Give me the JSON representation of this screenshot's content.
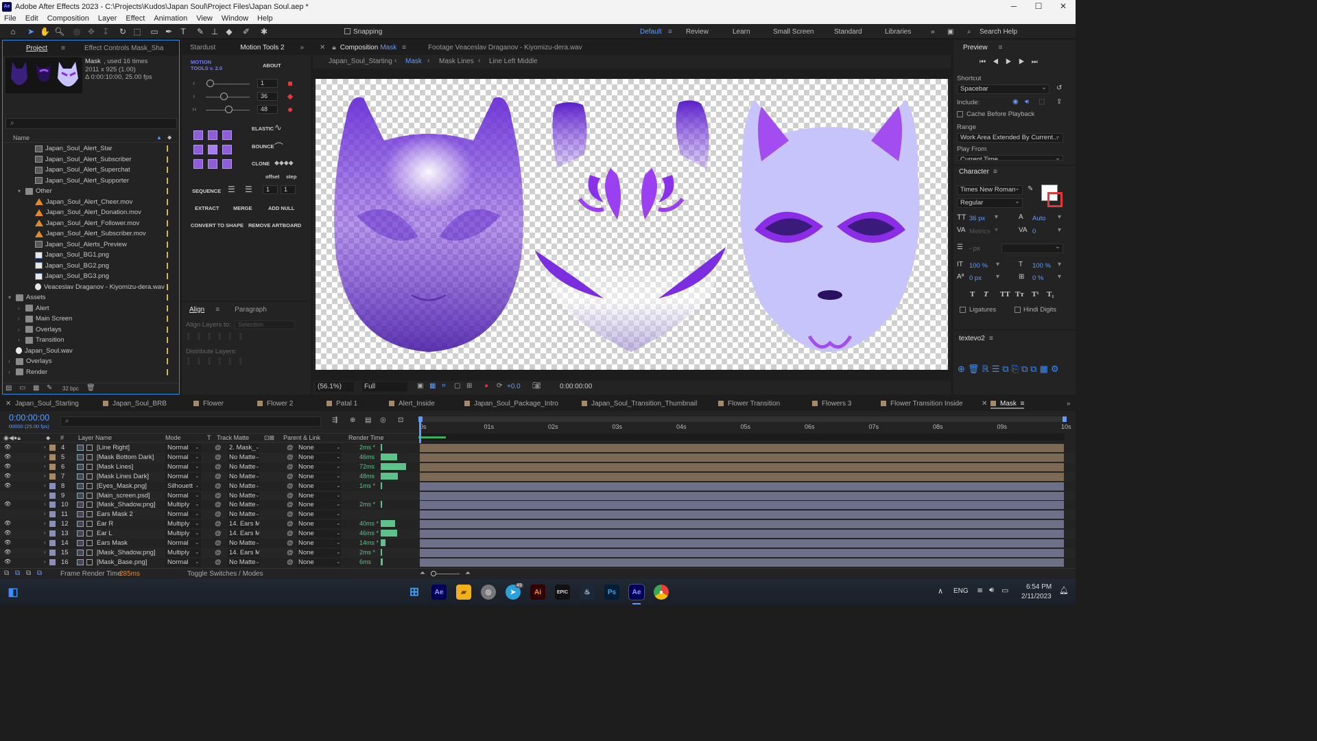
{
  "window": {
    "title": "Adobe After Effects 2023 - C:\\Projects\\Kudos\\Japan Soul\\Project Files\\Japan Soul.aep *",
    "app_badge": "Ae",
    "minimize": "─",
    "maximize": "☐",
    "close": "✕"
  },
  "menu": [
    "File",
    "Edit",
    "Composition",
    "Layer",
    "Effect",
    "Animation",
    "View",
    "Window",
    "Help"
  ],
  "toolbar": {
    "snapping": "Snapping",
    "workspaces": [
      "Default",
      "Review",
      "Learn",
      "Small Screen",
      "Standard",
      "Libraries"
    ],
    "active_workspace": "Default",
    "search_placeholder": "Search Help"
  },
  "project": {
    "tab_project": "Project",
    "tab_effect_controls": "Effect Controls  Mask_Sha",
    "selected_name": "Mask",
    "used_times": ", used 16 times",
    "dims": "2011 x 925 (1.00)",
    "duration": "Δ 0:00:10:00, 25.00 fps",
    "search_placeholder": "",
    "column_name": "Name",
    "bpc": "32 bpc",
    "items": [
      {
        "name": "Japan_Soul_Alert_Star",
        "type": "comp",
        "indent": 2
      },
      {
        "name": "Japan_Soul_Alert_Subscriber",
        "type": "comp",
        "indent": 2
      },
      {
        "name": "Japan_Soul_Alert_Superchat",
        "type": "comp",
        "indent": 2
      },
      {
        "name": "Japan_Soul_Alert_Supporter",
        "type": "comp",
        "indent": 2
      },
      {
        "name": "Other",
        "type": "folder",
        "indent": 1,
        "open": true
      },
      {
        "name": "Japan_Soul_Alert_Cheer.mov",
        "type": "mov",
        "indent": 2
      },
      {
        "name": "Japan_Soul_Alert_Donation.mov",
        "type": "mov",
        "indent": 2
      },
      {
        "name": "Japan_Soul_Alert_Follower.mov",
        "type": "mov",
        "indent": 2
      },
      {
        "name": "Japan_Soul_Alert_Subscriber.mov",
        "type": "mov",
        "indent": 2
      },
      {
        "name": "Japan_Soul_Alerts_Preview",
        "type": "comp",
        "indent": 2
      },
      {
        "name": "Japan_Soul_BG1.png",
        "type": "img",
        "indent": 2
      },
      {
        "name": "Japan_Soul_BG2.png",
        "type": "img",
        "indent": 2
      },
      {
        "name": "Japan_Soul_BG3.png",
        "type": "img",
        "indent": 2
      },
      {
        "name": "Veaceslav Draganov - Kiyomizu-dera.wav",
        "type": "wav",
        "indent": 2
      },
      {
        "name": "Assets",
        "type": "folder",
        "indent": 0,
        "open": true
      },
      {
        "name": "Alert",
        "type": "folder",
        "indent": 1
      },
      {
        "name": "Main Screen",
        "type": "folder",
        "indent": 1
      },
      {
        "name": "Overlays",
        "type": "folder",
        "indent": 1
      },
      {
        "name": "Transition",
        "type": "folder",
        "indent": 1
      },
      {
        "name": "Japan_Soul.wav",
        "type": "wav",
        "indent": 0
      },
      {
        "name": "Overlays",
        "type": "folder",
        "indent": 0
      },
      {
        "name": "Render",
        "type": "folder",
        "indent": 0
      }
    ]
  },
  "motion_tools": {
    "tab_stardust": "Stardust",
    "tab_motion": "Motion Tools 2",
    "logo_line1": "MOTION",
    "logo_line2": "TOOLS v. 2.0",
    "about": "ABOUT",
    "values": [
      "1",
      "36",
      "48"
    ],
    "elastic": "ELASTIC",
    "bounce": "BOUNCE",
    "clone": "CLONE",
    "offset": "offset",
    "step": "step",
    "sequence": "SEQUENCE",
    "seq_values": [
      "1",
      "1"
    ],
    "extract": "EXTRACT",
    "merge": "MERGE",
    "add_null": "ADD NULL",
    "convert": "CONVERT TO SHAPE",
    "remove": "REMOVE ARTBOARD"
  },
  "align": {
    "tab_align": "Align",
    "tab_paragraph": "Paragraph",
    "align_to": "Align Layers to:",
    "selection": "Selection",
    "distribute": "Distribute Layers:"
  },
  "composition": {
    "tab_label": "Composition",
    "comp_name": "Mask",
    "footage_tab": "Footage  Veaceslav Draganov - Kiyomizu-dera.wav",
    "breadcrumbs": [
      "Japan_Soul_Starting",
      "Mask",
      "Mask Lines",
      "Line Left Middle"
    ],
    "zoom": "(56.1%)",
    "quality": "Full",
    "exposure": "+0.0",
    "timecode": "0:00:00:00"
  },
  "preview": {
    "title": "Preview",
    "shortcut_label": "Shortcut",
    "shortcut": "Spacebar",
    "include": "Include:",
    "cache": "Cache Before Playback",
    "range_label": "Range",
    "range": "Work Area Extended By Current...",
    "play_from": "Play From",
    "play_from_value": "Current Time"
  },
  "character": {
    "title": "Character",
    "font": "Times New Roman",
    "style": "Regular",
    "size": "36 px",
    "leading": "Auto",
    "kerning": "Metrics",
    "tracking": "0",
    "stroke": "- px",
    "vscale": "100 %",
    "hscale": "100 %",
    "baseline": "0 px",
    "tsume": "0 %",
    "styles": [
      "T",
      "T",
      "TT",
      "Tт",
      "T¹",
      "T₁"
    ],
    "ligatures": "Ligatures",
    "hindi": "Hindi Digits"
  },
  "textevo": {
    "title": "textevo2"
  },
  "timeline": {
    "tabs": [
      "Japan_Soul_Starting",
      "Japan_Soul_BRB",
      "Flower",
      "Flower 2",
      "Patal 1",
      "Alert_Inside",
      "Japan_Soul_Package_Intro",
      "Japan_Soul_Transition_Thumbnail",
      "Flower Transition",
      "Flowers 3",
      "Flower Transition Inside",
      "Mask"
    ],
    "timecode": "0:00:00:00",
    "fps": "00000 (25.00 fps)",
    "headers": {
      "num": "#",
      "layer_name": "Layer Name",
      "mode": "Mode",
      "t": "T",
      "track_matte": "Track Matte",
      "parent": "Parent & Link",
      "render_time": "Render Time"
    },
    "ruler": [
      "0s",
      "01s",
      "02s",
      "03s",
      "04s",
      "05s",
      "06s",
      "07s",
      "08s",
      "09s",
      "10s"
    ],
    "layers": [
      {
        "num": "4",
        "name": "[Line Right]",
        "mode": "Normal",
        "matte": "2. Mask_",
        "parent": "None",
        "rt": "2ms *",
        "rt_ms": 2,
        "color": "#a58a6a",
        "visible": true
      },
      {
        "num": "5",
        "name": "[Mask Bottom Dark]",
        "mode": "Normal",
        "matte": "No Matte",
        "parent": "None",
        "rt": "46ms",
        "rt_ms": 46,
        "color": "#a58a6a",
        "visible": true
      },
      {
        "num": "6",
        "name": "[Mask Lines]",
        "mode": "Normal",
        "matte": "No Matte",
        "parent": "None",
        "rt": "72ms",
        "rt_ms": 72,
        "color": "#a58a6a",
        "visible": true
      },
      {
        "num": "7",
        "name": "[Mask Lines Dark]",
        "mode": "Normal",
        "matte": "No Matte",
        "parent": "None",
        "rt": "48ms",
        "rt_ms": 48,
        "color": "#a58a6a",
        "visible": true
      },
      {
        "num": "8",
        "name": "[Eyes_Mask.png]",
        "mode": "Silhouett",
        "matte": "No Matte",
        "parent": "None",
        "rt": "1ms *",
        "rt_ms": 1,
        "color": "#8a8fb5",
        "visible": true
      },
      {
        "num": "9",
        "name": "[Main_screen.psd]",
        "mode": "Normal",
        "matte": "No Matte",
        "parent": "None",
        "rt": "",
        "rt_ms": 0,
        "color": "#8a8fb5",
        "visible": false
      },
      {
        "num": "10",
        "name": "[Mask_Shadow.png]",
        "mode": "Multiply",
        "matte": "No Matte",
        "parent": "None",
        "rt": "2ms *",
        "rt_ms": 2,
        "color": "#8a8fb5",
        "visible": true
      },
      {
        "num": "11",
        "name": "Ears Mask 2",
        "mode": "Normal",
        "matte": "No Matte",
        "parent": "None",
        "rt": "",
        "rt_ms": 0,
        "color": "#8a8fb5",
        "visible": false
      },
      {
        "num": "12",
        "name": "Ear R",
        "mode": "Multiply",
        "matte": "14. Ears M",
        "parent": "None",
        "rt": "40ms *",
        "rt_ms": 40,
        "color": "#8a8fb5",
        "visible": true
      },
      {
        "num": "13",
        "name": "Ear L",
        "mode": "Multiply",
        "matte": "14. Ears M",
        "parent": "None",
        "rt": "46ms *",
        "rt_ms": 46,
        "color": "#8a8fb5",
        "visible": true
      },
      {
        "num": "14",
        "name": "Ears Mask",
        "mode": "Normal",
        "matte": "No Matte",
        "parent": "None",
        "rt": "14ms *",
        "rt_ms": 14,
        "color": "#8a8fb5",
        "visible": true
      },
      {
        "num": "15",
        "name": "[Mask_Shadow.png]",
        "mode": "Multiply",
        "matte": "14. Ears M",
        "parent": "None",
        "rt": "2ms *",
        "rt_ms": 2,
        "color": "#8a8fb5",
        "visible": true
      },
      {
        "num": "16",
        "name": "[Mask_Base.png]",
        "mode": "Normal",
        "matte": "No Matte",
        "parent": "None",
        "rt": "6ms",
        "rt_ms": 6,
        "color": "#8a8fb5",
        "visible": true
      }
    ],
    "frame_render_label": "Frame Render Time:",
    "frame_render_value": "285ms",
    "toggle": "Toggle Switches / Modes"
  },
  "taskbar": {
    "lang": "ENG",
    "time": "6:54 PM",
    "date": "2/11/2023",
    "telegram_badge": "49"
  }
}
